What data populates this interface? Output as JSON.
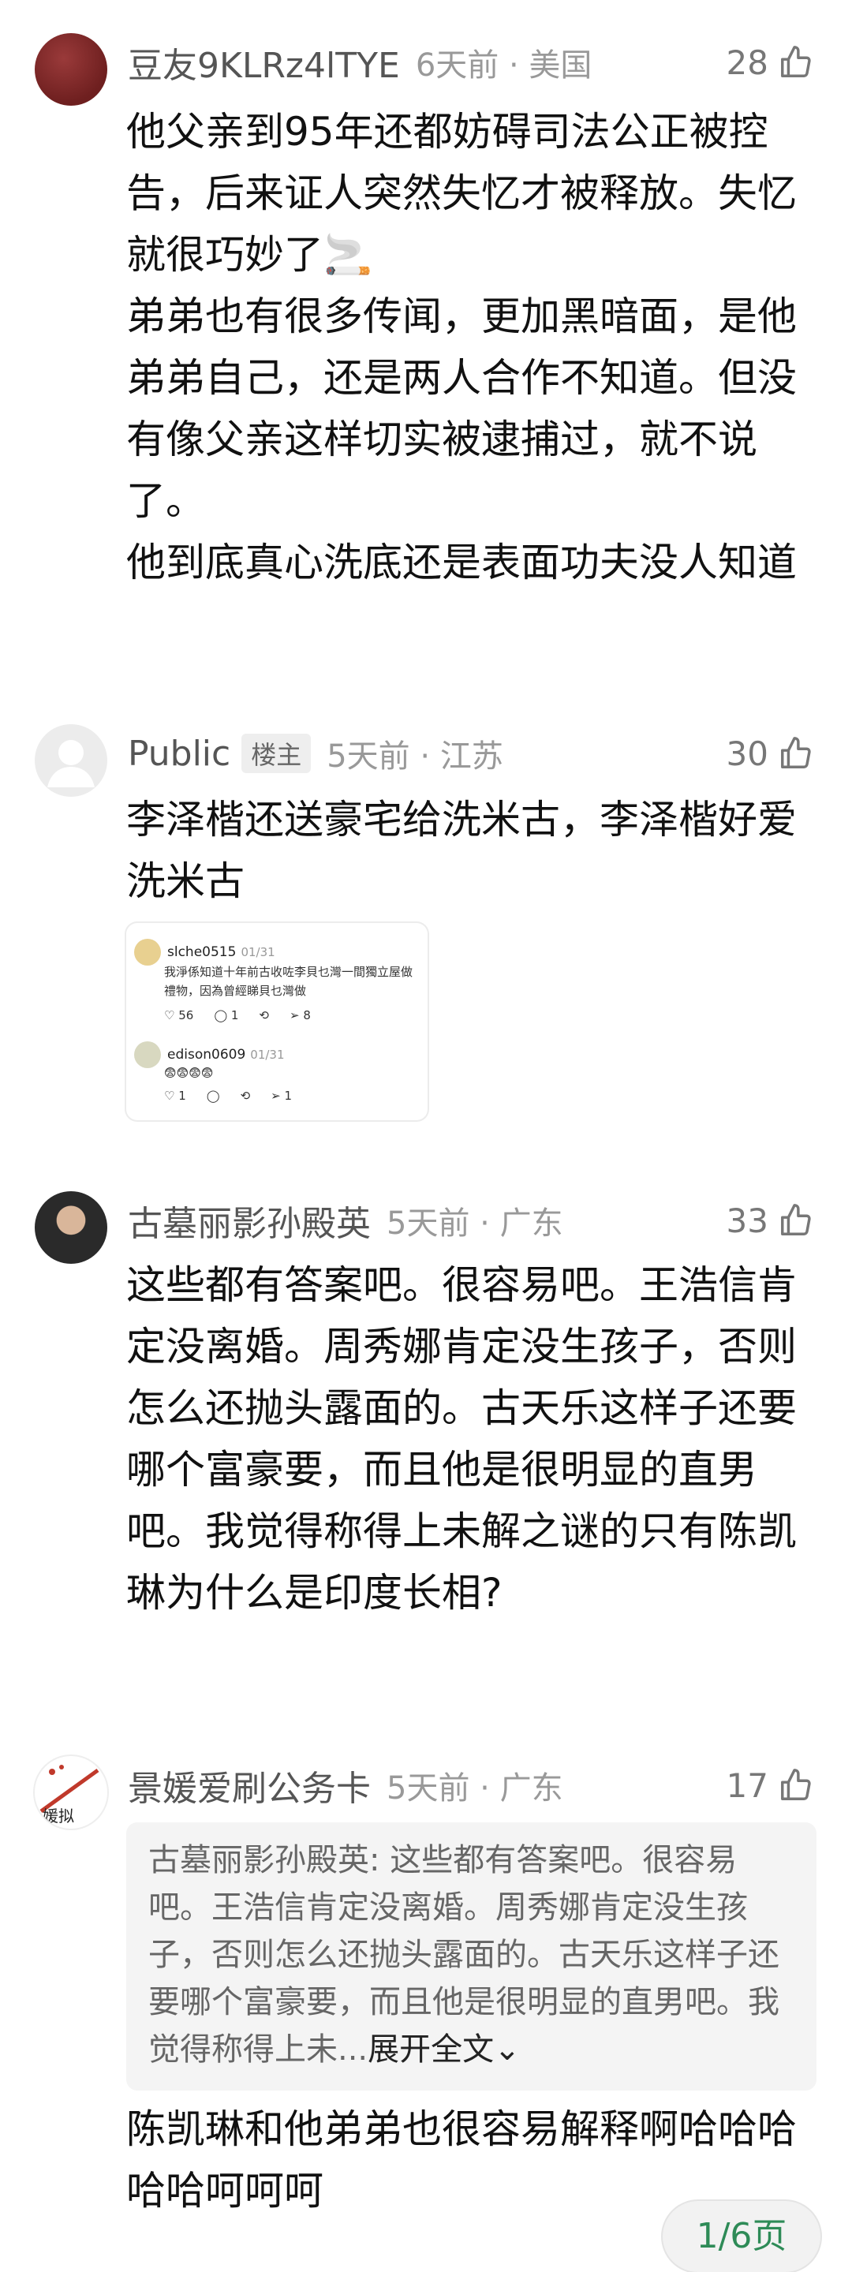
{
  "comments": [
    {
      "username": "豆友9KLRz4lTYE",
      "time_location": "6天前 · 美国",
      "likes": "28",
      "text": "他父亲到95年还都妨碍司法公正被控告，后来证人突然失忆才被释放。失忆就很巧妙了🚬\n弟弟也有很多传闻，更加黑暗面，是他弟弟自己，还是两人合作不知道。但没有像父亲这样切实被逮捕过，就不说了。\n他到底真心洗底还是表面功夫没人知道"
    },
    {
      "username": "Public",
      "tag": "楼主",
      "time_location": "5天前 · 江苏",
      "likes": "30",
      "text": "李泽楷还送豪宅给洗米古，李泽楷好爱洗米古",
      "image": {
        "post1": {
          "user": "slche0515",
          "date": "01/31",
          "text": "我淨係知道十年前古收咗李貝乜灣一間獨立屋做禮物，因為曾經睇貝乜灣做",
          "likes": "56",
          "replies": "1",
          "shares": "8"
        },
        "post2": {
          "user": "edison0609",
          "date": "01/31",
          "text": "😨😨😨😨",
          "likes": "1",
          "shares": "1"
        }
      }
    },
    {
      "username": "古墓丽影孙殿英",
      "time_location": "5天前 · 广东",
      "likes": "33",
      "text": "这些都有答案吧。很容易吧。王浩信肯定没离婚。周秀娜肯定没生孩子，否则怎么还抛头露面的。古天乐这样子还要哪个富豪要，而且他是很明显的直男吧。我觉得称得上未解之谜的只有陈凯琳为什么是印度长相?"
    },
    {
      "username": "景媛爱刷公务卡",
      "time_location": "5天前 · 广东",
      "likes": "17",
      "quote": "古墓丽影孙殿英: 这些都有答案吧。很容易吧。王浩信肯定没离婚。周秀娜肯定没生孩子，否则怎么还抛头露面的。古天乐这样子还要哪个富豪要，而且他是很明显的直男吧。我觉得称得上未...",
      "expand": "展开全文⌄",
      "text": "陈凯琳和他弟弟也很容易解释啊哈哈哈哈哈呵呵呵",
      "avatar_text": "媛拟"
    }
  ],
  "pager": "1/6页",
  "colors": {
    "accent_green": "#2e8b57",
    "meta_gray": "#999999",
    "quote_bg": "#f4f4f4"
  }
}
